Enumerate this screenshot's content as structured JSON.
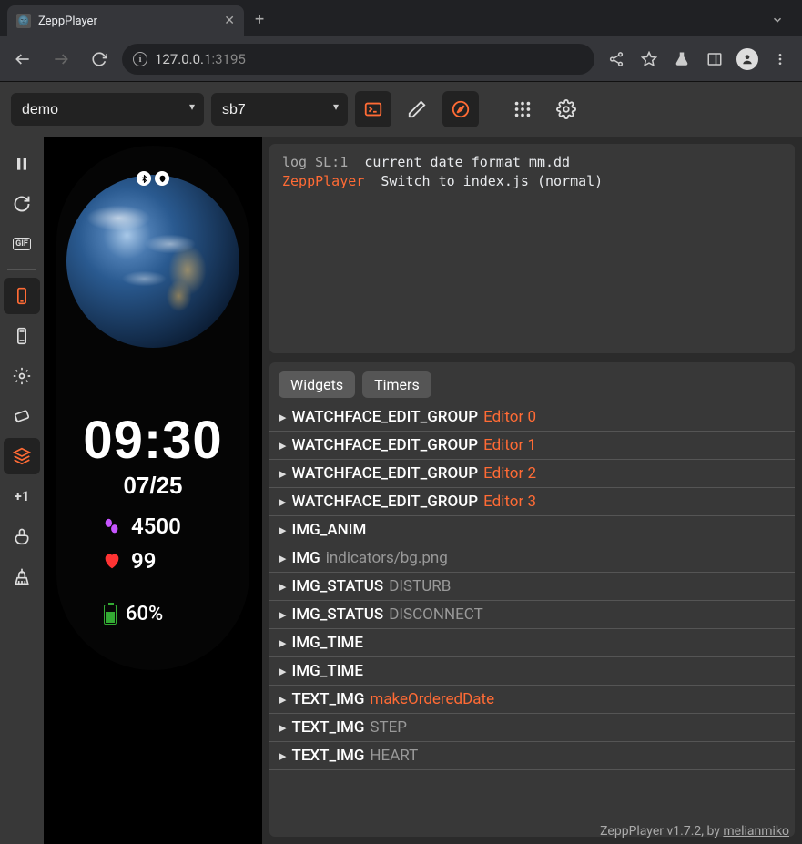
{
  "browser": {
    "tab_title": "ZeppPlayer",
    "url_host": "127.0.0.1",
    "url_port": ":3195"
  },
  "toolbar": {
    "select_project": "demo",
    "select_device": "sb7"
  },
  "sidetools": {
    "shift": "+1"
  },
  "watchface": {
    "time": "09:30",
    "date": "07/25",
    "steps": "4500",
    "heart": "99",
    "battery": "60%"
  },
  "console": {
    "line1_prefix": "log  SL:1",
    "line1_text": "current date format  mm.dd",
    "line2_prefix": "ZeppPlayer",
    "line2_text": "Switch to  index.js  (normal)"
  },
  "inspector": {
    "tabs": {
      "widgets": "Widgets",
      "timers": "Timers"
    },
    "rows": [
      {
        "name": "WATCHFACE_EDIT_GROUP",
        "detail": "Editor 0",
        "style": "orange"
      },
      {
        "name": "WATCHFACE_EDIT_GROUP",
        "detail": "Editor 1",
        "style": "orange"
      },
      {
        "name": "WATCHFACE_EDIT_GROUP",
        "detail": "Editor 2",
        "style": "orange"
      },
      {
        "name": "WATCHFACE_EDIT_GROUP",
        "detail": "Editor 3",
        "style": "orange"
      },
      {
        "name": "IMG_ANIM",
        "detail": "",
        "style": ""
      },
      {
        "name": "IMG",
        "detail": "indicators/bg.png",
        "style": "dim"
      },
      {
        "name": "IMG_STATUS",
        "detail": "DISTURB",
        "style": "dim"
      },
      {
        "name": "IMG_STATUS",
        "detail": "DISCONNECT",
        "style": "dim"
      },
      {
        "name": "IMG_TIME",
        "detail": "",
        "style": ""
      },
      {
        "name": "IMG_TIME",
        "detail": "",
        "style": ""
      },
      {
        "name": "TEXT_IMG",
        "detail": "makeOrderedDate",
        "style": "orange"
      },
      {
        "name": "TEXT_IMG",
        "detail": "STEP",
        "style": "dim"
      },
      {
        "name": "TEXT_IMG",
        "detail": "HEART",
        "style": "dim"
      }
    ]
  },
  "footer": {
    "text": "ZeppPlayer v1.7.2, by ",
    "author": "melianmiko"
  }
}
